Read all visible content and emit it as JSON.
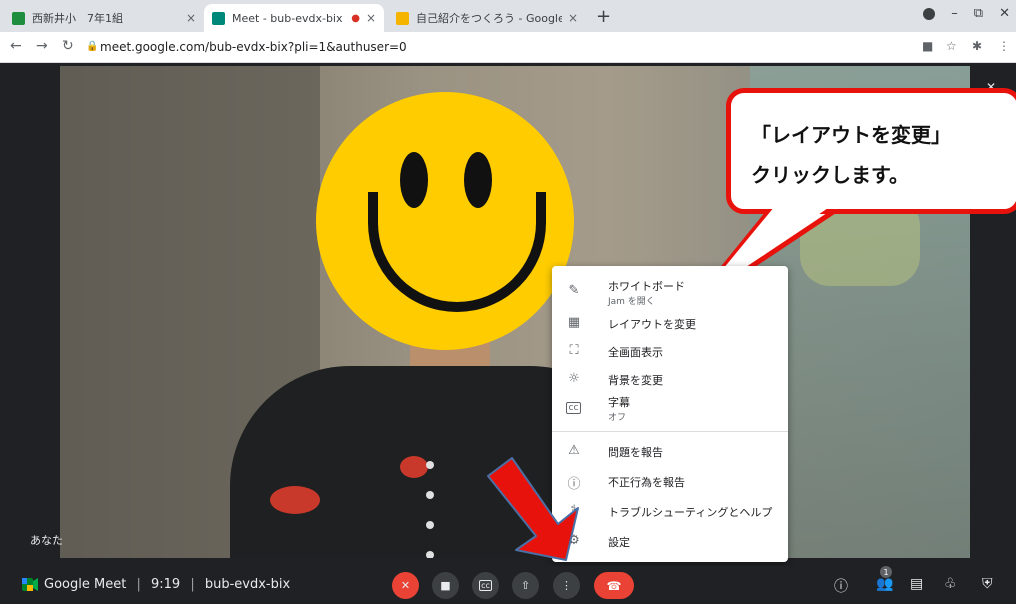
{
  "tabs": [
    {
      "title": "西新井小　7年1組",
      "close": "×",
      "favicon_color": "#1e8e3e"
    },
    {
      "title": "Meet - bub-evdx-bix",
      "close": "×",
      "recording": "●",
      "favicon_color": "#00897b"
    },
    {
      "title": "自己紹介をつくろう - Google",
      "close": "×",
      "favicon_color": "#f4b400"
    }
  ],
  "new_tab": "+",
  "address": {
    "url": "meet.google.com/bub-evdx-bix?pli=1&authuser=0"
  },
  "video": {
    "you_label": "あなた"
  },
  "callout": {
    "line1": "「レイアウトを変更」",
    "line2": "クリックします。"
  },
  "menu": {
    "items": [
      {
        "icon": "pencil-icon",
        "label": "ホワイトボード",
        "sub": "Jam を開く"
      },
      {
        "icon": "layout-icon",
        "label": "レイアウトを変更"
      },
      {
        "icon": "fullscreen-icon",
        "label": "全画面表示"
      },
      {
        "icon": "background-icon",
        "label": "背景を変更"
      },
      {
        "icon": "captions-icon",
        "label": "字幕",
        "sub": "オフ"
      },
      {
        "icon": "report-icon",
        "label": "問題を報告"
      },
      {
        "icon": "abuse-icon",
        "label": "不正行為を報告"
      },
      {
        "icon": "help-icon",
        "label": "トラブルシューティングとヘルプ"
      },
      {
        "icon": "gear-icon",
        "label": "設定"
      }
    ]
  },
  "bottom": {
    "app_name": "Google Meet",
    "separator": "|",
    "time": "9:19",
    "meeting_code": "bub-evdx-bix",
    "participants_count": "1"
  },
  "colors": {
    "end_call": "#ea4335",
    "callout_border": "#e8120c",
    "face": "#ffcc00"
  }
}
